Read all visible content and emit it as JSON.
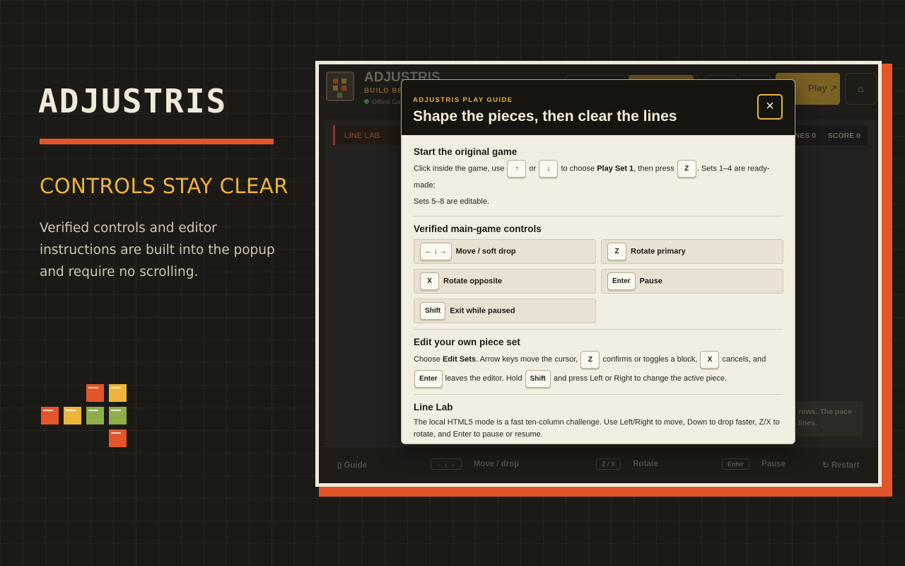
{
  "brand": {
    "title": "ADJUSTRIS",
    "tagline": "CONTROLS STAY CLEAR",
    "blurb": "Verified controls and editor instructions are built into the popup and require no scrolling."
  },
  "colors": {
    "accent_orange": "#e2562a",
    "accent_yellow": "#eeb53d",
    "accent_green": "#8fae48",
    "background": "#1b1a17",
    "modal_bg": "#f3eee2"
  },
  "app": {
    "name": "ADJUSTRIS",
    "subtitle": "BUILD BET",
    "status": "Offline Ga",
    "play_label": "Play ↗",
    "home_icon": "home-icon",
    "mode_tab": "LINE LAB",
    "stats": [
      "LINES 0",
      "SCORE 0"
    ],
    "note_lines": [
      "rows. The pace",
      "lines."
    ],
    "footer": {
      "guide": "Guide",
      "move_keys": "← ↓ →",
      "move_label": "Move / drop",
      "rotate_keys": "Z / X",
      "rotate_label": "Rotate",
      "pause_key": "Enter",
      "pause_label": "Pause",
      "restart": "Restart"
    }
  },
  "modal": {
    "eyebrow": "ADJUSTRIS PLAY GUIDE",
    "title": "Shape the pieces, then clear the lines",
    "close": "×",
    "start": {
      "heading": "Start the original game",
      "t1": "Click inside the game, use",
      "k_up": "↑",
      "t_or": "or",
      "k_down": "↓",
      "t2": "to choose",
      "play_set": "Play Set 1",
      "t3": ", then press",
      "k_z": "Z",
      "t4": ". Sets 1–4 are ready-made;",
      "t5": "Sets 5–8 are editable."
    },
    "controls": {
      "heading": "Verified main-game controls",
      "items": [
        {
          "key": "← ↓ →",
          "label": "Move / soft drop"
        },
        {
          "key": "Z",
          "label": "Rotate primary"
        },
        {
          "key": "X",
          "label": "Rotate opposite"
        },
        {
          "key": "Enter",
          "label": "Pause"
        },
        {
          "key": "Shift",
          "label": "Exit while paused"
        }
      ]
    },
    "edit": {
      "heading": "Edit your own piece set",
      "t1": "Choose",
      "edit_sets": "Edit Sets",
      "t2": ". Arrow keys move the cursor,",
      "k_z": "Z",
      "t3": "confirms or toggles a block,",
      "k_x": "X",
      "t4": "cancels, and",
      "k_enter": "Enter",
      "t5": "leaves the editor. Hold",
      "k_shift": "Shift",
      "t6": "and press Left or Right to change the active piece."
    },
    "linelab": {
      "heading": "Line Lab",
      "text": "The local HTML5 mode is a fast ten-column challenge. Use Left/Right to move, Down to drop faster, Z/X to rotate, and Enter to pause or resume."
    }
  }
}
